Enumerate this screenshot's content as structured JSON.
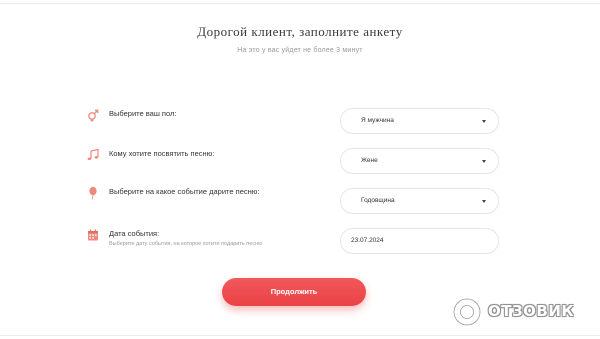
{
  "header": {
    "title": "Дорогой клиент, заполните анкету",
    "subtitle": "На это у вас уйдет не более 3 минут"
  },
  "form": {
    "gender": {
      "label": "Выберите ваш пол:",
      "value": "Я мужчина",
      "icon": "gender-icon"
    },
    "recipient": {
      "label": "Кому хотите посвятить песню:",
      "value": "Жене",
      "icon": "music-note-icon"
    },
    "occasion": {
      "label": "Выберите на какое событие дарите песню:",
      "value": "Годовщина",
      "icon": "balloon-icon"
    },
    "event_date": {
      "label": "Дата события:",
      "hint": "Выберите дату события, на которое хотите подарить песню",
      "value": "23.07.2024",
      "icon": "calendar-icon"
    }
  },
  "actions": {
    "continue_label": "Продолжить"
  },
  "watermark": {
    "text": "ОТЗОВИК"
  },
  "colors": {
    "accent": "#ea4245",
    "icon": "#f08a7e"
  }
}
